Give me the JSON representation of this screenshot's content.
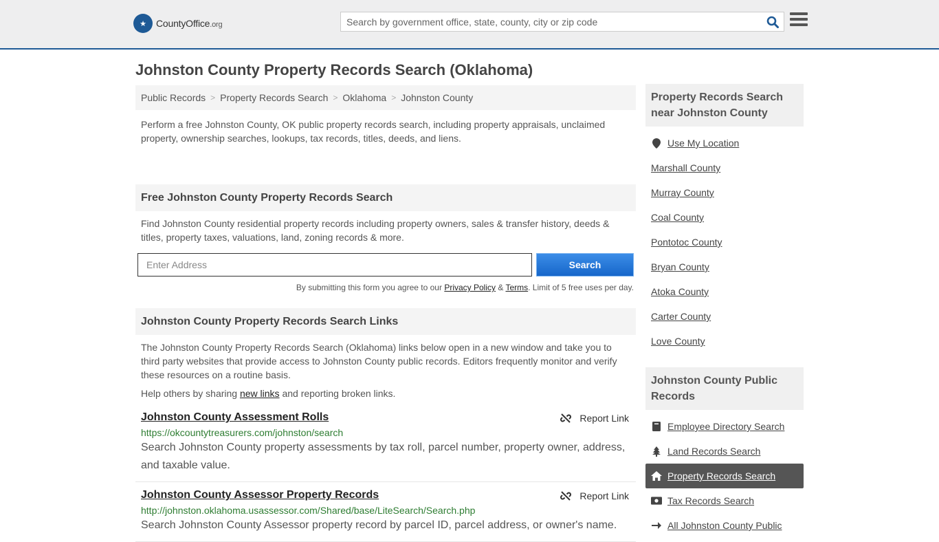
{
  "header": {
    "logo_main": "CountyOffice",
    "logo_suffix": ".org",
    "search_placeholder": "Search by government office, state, county, city or zip code"
  },
  "page_title": "Johnston County Property Records Search (Oklahoma)",
  "breadcrumb": [
    "Public Records",
    "Property Records Search",
    "Oklahoma",
    "Johnston County"
  ],
  "intro": "Perform a free Johnston County, OK public property records search, including property appraisals, unclaimed property, ownership searches, lookups, tax records, titles, deeds, and liens.",
  "free_search": {
    "heading": "Free Johnston County Property Records Search",
    "text": "Find Johnston County residential property records including property owners, sales & transfer history, deeds & titles, property taxes, valuations, land, zoning records & more.",
    "address_placeholder": "Enter Address",
    "button": "Search",
    "disclaimer_pre": "By submitting this form you agree to our ",
    "privacy": "Privacy Policy",
    "amp": " & ",
    "terms": "Terms",
    "disclaimer_post": ". Limit of 5 free uses per day."
  },
  "links_section": {
    "heading": "Johnston County Property Records Search Links",
    "text": "The Johnston County Property Records Search (Oklahoma) links below open in a new window and take you to third party websites that provide access to Johnston County public records. Editors frequently monitor and verify these resources on a routine basis.",
    "help_pre": "Help others by sharing ",
    "help_link": "new links",
    "help_post": " and reporting broken links.",
    "report_label": "Report Link",
    "items": [
      {
        "title": "Johnston County Assessment Rolls",
        "url": "https://okcountytreasurers.com/johnston/search",
        "desc": "Search Johnston County property assessments by tax roll, parcel number, property owner, address, and taxable value."
      },
      {
        "title": "Johnston County Assessor Property Records",
        "url": "http://johnston.oklahoma.usassessor.com/Shared/base/LiteSearch/Search.php",
        "desc": "Search Johnston County Assessor property record by parcel ID, parcel address, or owner's name."
      }
    ]
  },
  "sidebar": {
    "nearby_heading": "Property Records Search near Johnston County",
    "use_location": "Use My Location",
    "nearby": [
      "Marshall County",
      "Murray County",
      "Coal County",
      "Pontotoc County",
      "Bryan County",
      "Atoka County",
      "Carter County",
      "Love County"
    ],
    "public_heading": "Johnston County Public Records",
    "public_items": [
      {
        "label": "Employee Directory Search",
        "icon": "book-icon"
      },
      {
        "label": "Land Records Search",
        "icon": "tree-icon"
      },
      {
        "label": "Property Records Search",
        "icon": "home-icon"
      },
      {
        "label": "Tax Records Search",
        "icon": "money-icon"
      },
      {
        "label": "All Johnston County Public",
        "icon": "arrow-right-icon"
      }
    ]
  },
  "colors": {
    "brand": "#1e5a96",
    "url_green": "#2e7d32",
    "button_blue": "#1565c9"
  }
}
